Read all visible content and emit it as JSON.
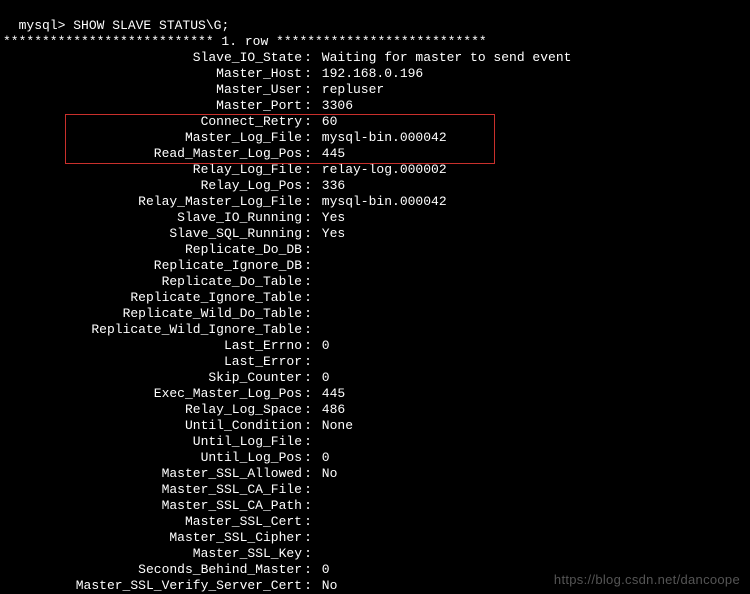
{
  "prompt": "mysql> ",
  "command": "SHOW SLAVE STATUS\\G;",
  "row_header": "*************************** 1. row ***************************",
  "fields": [
    {
      "label": "Slave_IO_State",
      "value": "Waiting for master to send event"
    },
    {
      "label": "Master_Host",
      "value": "192.168.0.196"
    },
    {
      "label": "Master_User",
      "value": "repluser"
    },
    {
      "label": "Master_Port",
      "value": "3306"
    },
    {
      "label": "Connect_Retry",
      "value": "60"
    },
    {
      "label": "Master_Log_File",
      "value": "mysql-bin.000042"
    },
    {
      "label": "Read_Master_Log_Pos",
      "value": "445"
    },
    {
      "label": "Relay_Log_File",
      "value": "relay-log.000002"
    },
    {
      "label": "Relay_Log_Pos",
      "value": "336"
    },
    {
      "label": "Relay_Master_Log_File",
      "value": "mysql-bin.000042"
    },
    {
      "label": "Slave_IO_Running",
      "value": "Yes"
    },
    {
      "label": "Slave_SQL_Running",
      "value": "Yes"
    },
    {
      "label": "Replicate_Do_DB",
      "value": ""
    },
    {
      "label": "Replicate_Ignore_DB",
      "value": ""
    },
    {
      "label": "Replicate_Do_Table",
      "value": ""
    },
    {
      "label": "Replicate_Ignore_Table",
      "value": ""
    },
    {
      "label": "Replicate_Wild_Do_Table",
      "value": ""
    },
    {
      "label": "Replicate_Wild_Ignore_Table",
      "value": ""
    },
    {
      "label": "Last_Errno",
      "value": "0"
    },
    {
      "label": "Last_Error",
      "value": ""
    },
    {
      "label": "Skip_Counter",
      "value": "0"
    },
    {
      "label": "Exec_Master_Log_Pos",
      "value": "445"
    },
    {
      "label": "Relay_Log_Space",
      "value": "486"
    },
    {
      "label": "Until_Condition",
      "value": "None"
    },
    {
      "label": "Until_Log_File",
      "value": ""
    },
    {
      "label": "Until_Log_Pos",
      "value": "0"
    },
    {
      "label": "Master_SSL_Allowed",
      "value": "No"
    },
    {
      "label": "Master_SSL_CA_File",
      "value": ""
    },
    {
      "label": "Master_SSL_CA_Path",
      "value": ""
    },
    {
      "label": "Master_SSL_Cert",
      "value": ""
    },
    {
      "label": "Master_SSL_Cipher",
      "value": ""
    },
    {
      "label": "Master_SSL_Key",
      "value": ""
    },
    {
      "label": "Seconds_Behind_Master",
      "value": "0"
    },
    {
      "label": "Master_SSL_Verify_Server_Cert",
      "value": "No"
    }
  ],
  "watermark": "https://blog.csdn.net/dancoope",
  "highlight": {
    "start_index": 4,
    "end_index": 6
  }
}
